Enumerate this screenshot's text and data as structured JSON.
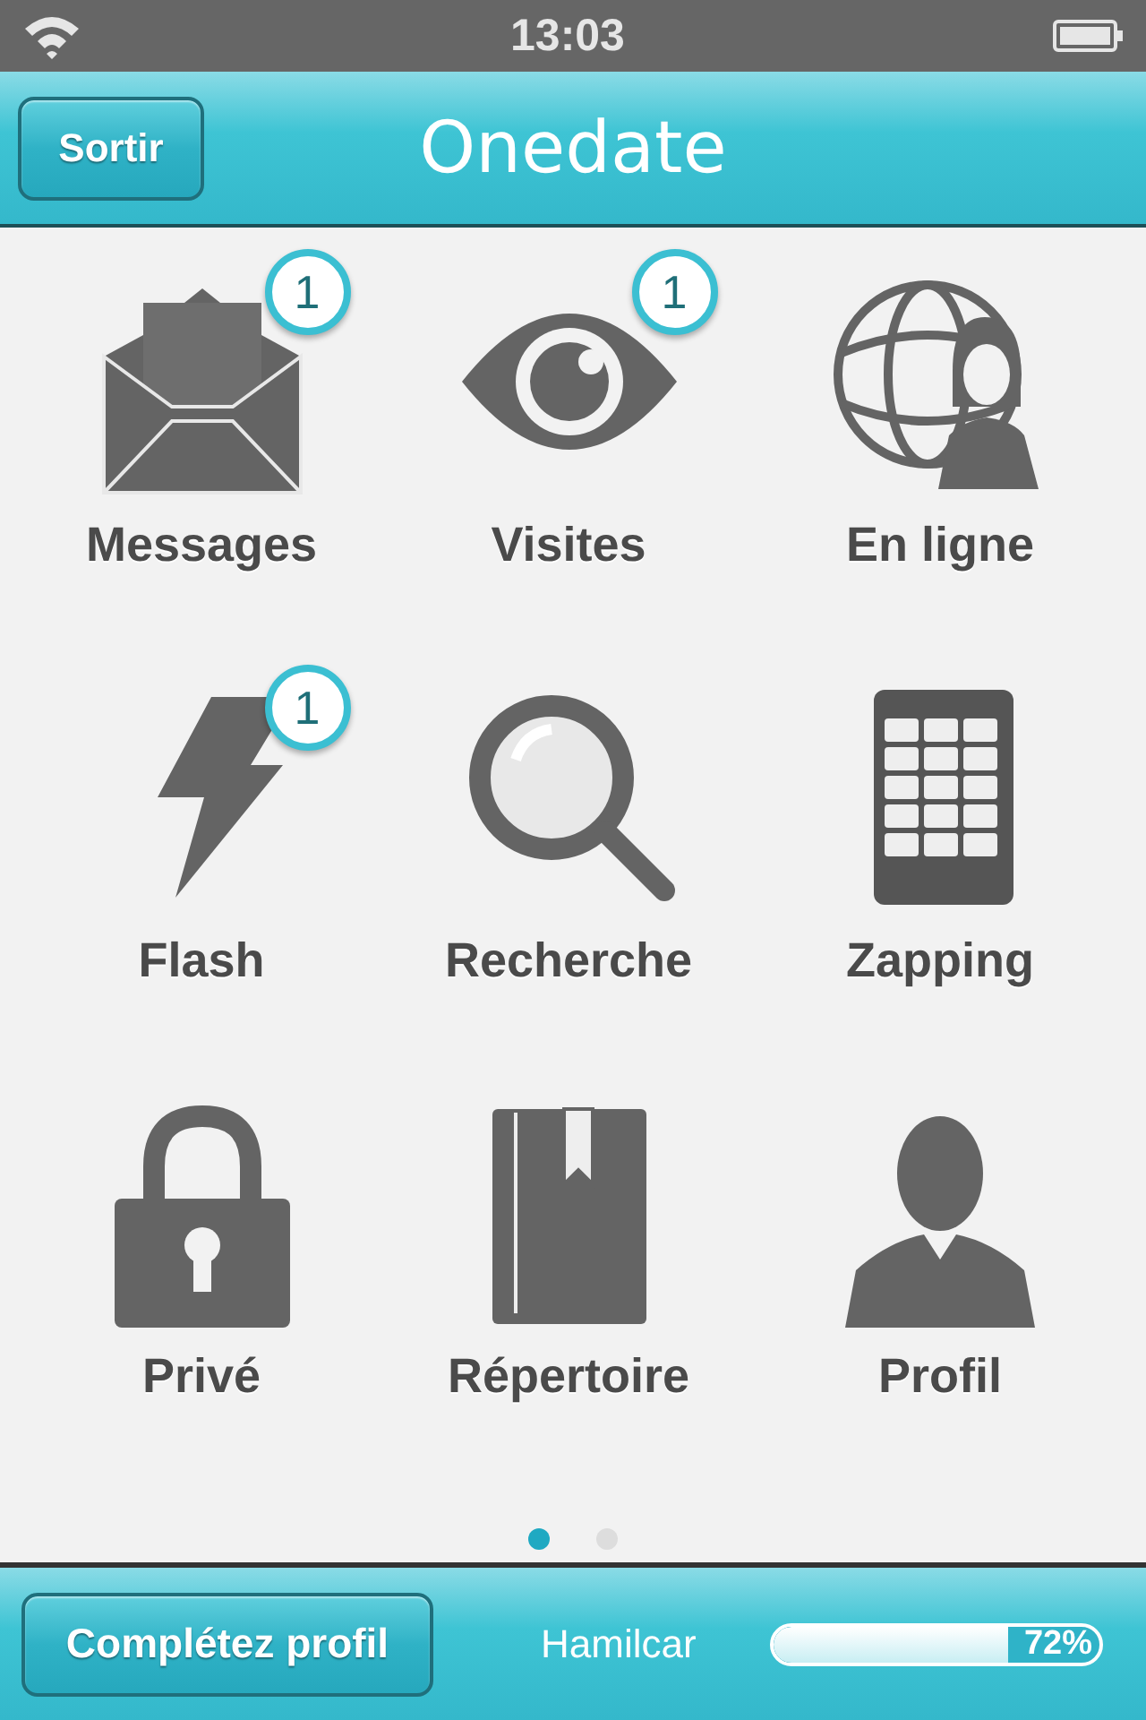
{
  "status_bar": {
    "time": "13:03"
  },
  "header": {
    "button": "Sortir",
    "logo": "Onedate"
  },
  "tiles": [
    {
      "label": "Messages",
      "kind": "envelope",
      "badge": "1"
    },
    {
      "label": "Visites",
      "kind": "eye",
      "badge": "1"
    },
    {
      "label": "En ligne",
      "kind": "globe"
    },
    {
      "label": "Flash",
      "kind": "bolt",
      "badge": "1"
    },
    {
      "label": "Recherche",
      "kind": "magnifier"
    },
    {
      "label": "Zapping",
      "kind": "keypad"
    },
    {
      "label": "Privé",
      "kind": "lock"
    },
    {
      "label": "Répertoire",
      "kind": "book"
    },
    {
      "label": "Profil",
      "kind": "person"
    }
  ],
  "page_dots": [
    {
      "selected": true
    },
    {
      "selected": false
    }
  ],
  "footer": {
    "button": "Complétez profil",
    "username": "Hamilcar",
    "profile_progress": {
      "level": 0.72,
      "reading": "72%"
    }
  }
}
